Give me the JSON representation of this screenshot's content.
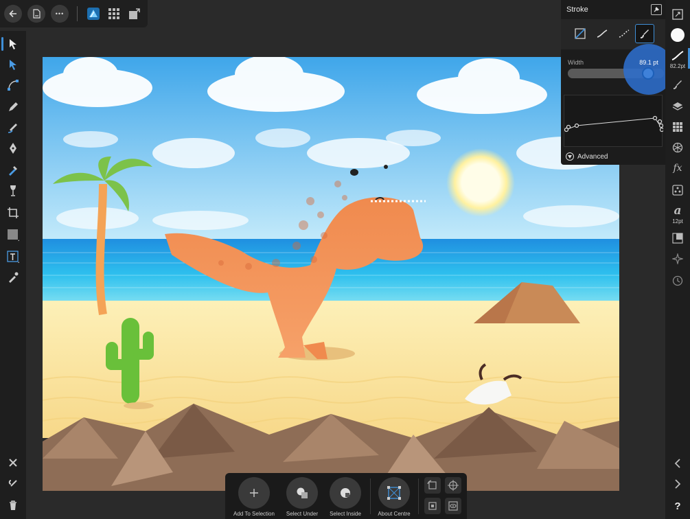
{
  "app": {
    "accent_color": "#3f8fd8",
    "panel_bg": "#1c1c1c"
  },
  "top_toolbar": {
    "back_icon": "back-arrow-icon",
    "documents_icon": "document-icon",
    "more_label": "•••",
    "personas": [
      "designer-persona-icon",
      "pixel-persona-icon",
      "export-persona-icon"
    ]
  },
  "stroke_panel": {
    "title": "Stroke",
    "styles": [
      "none",
      "solid",
      "dashed",
      "brush"
    ],
    "selected_style": "brush",
    "width_label": "Width",
    "width_value": "89.1 pt",
    "width_fraction": 0.78,
    "advanced_label": "Advanced"
  },
  "right_toolbar": {
    "stroke_width_label": "82.2pt",
    "text_size_label": "12pt",
    "help_label": "?"
  },
  "bottom_toolbar": {
    "add_to_selection": "Add To Selection",
    "select_under": "Select Under",
    "select_inside": "Select Inside",
    "about_centre": "About Centre"
  }
}
